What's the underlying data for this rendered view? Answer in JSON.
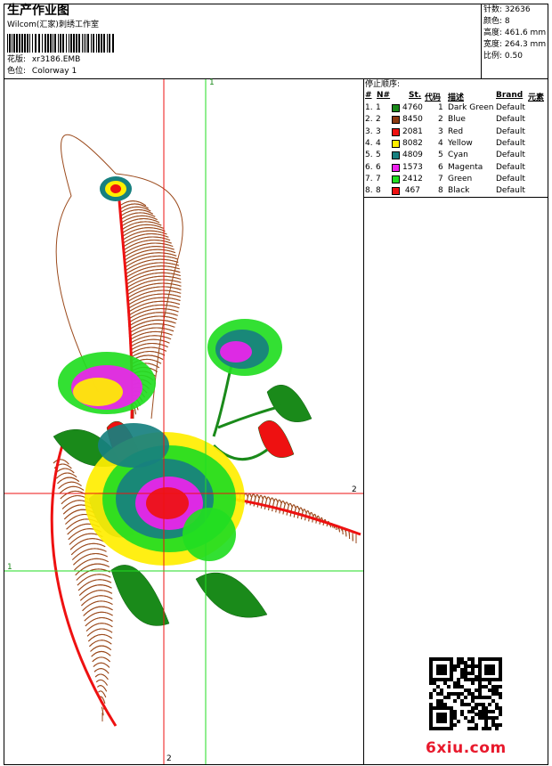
{
  "header": {
    "title": "生产作业图",
    "company": "Wilcom(汇家)刺绣工作室",
    "design_label": "花版:",
    "design_file": "xr3186.EMB",
    "colorway_label": "色位:",
    "colorway": "Colorway 1"
  },
  "stats": {
    "stitches_label": "针数:",
    "stitches": "32636",
    "colors_label": "颜色:",
    "colors": "8",
    "height_label": "高度:",
    "height": "461.6 mm",
    "width_label": "宽度:",
    "width": "264.3 mm",
    "scale_label": "比例:",
    "scale": "0.50"
  },
  "sequence": {
    "title": "停止顺序:",
    "columns": [
      "#",
      "N#",
      "St.",
      "代码",
      "描述",
      "Brand",
      "元素"
    ],
    "rows": [
      {
        "num": "1.",
        "n": "1",
        "color": "#1a8a1a",
        "st": "4760",
        "code": "1",
        "desc": "Dark Green",
        "brand": "Default"
      },
      {
        "num": "2.",
        "n": "2",
        "color": "#8b3a12",
        "st": "8450",
        "code": "2",
        "desc": "Blue",
        "brand": "Default"
      },
      {
        "num": "3.",
        "n": "3",
        "color": "#ee1111",
        "st": "2081",
        "code": "3",
        "desc": "Red",
        "brand": "Default"
      },
      {
        "num": "4.",
        "n": "4",
        "color": "#ffee00",
        "st": "8082",
        "code": "4",
        "desc": "Yellow",
        "brand": "Default"
      },
      {
        "num": "5.",
        "n": "5",
        "color": "#17807f",
        "st": "4809",
        "code": "5",
        "desc": "Cyan",
        "brand": "Default"
      },
      {
        "num": "6.",
        "n": "6",
        "color": "#ee22ee",
        "st": "1573",
        "code": "6",
        "desc": "Magenta",
        "brand": "Default"
      },
      {
        "num": "7.",
        "n": "7",
        "color": "#22dd22",
        "st": "2412",
        "code": "7",
        "desc": "Green",
        "brand": "Default"
      },
      {
        "num": "8.",
        "n": "8",
        "color": "#ee1111",
        "st": "467",
        "code": "8",
        "desc": "Black",
        "brand": "Default"
      }
    ]
  },
  "guides": {
    "v1": "1",
    "v2": "2",
    "h1": "1",
    "h2": "2"
  },
  "watermark": "6xiu.com"
}
